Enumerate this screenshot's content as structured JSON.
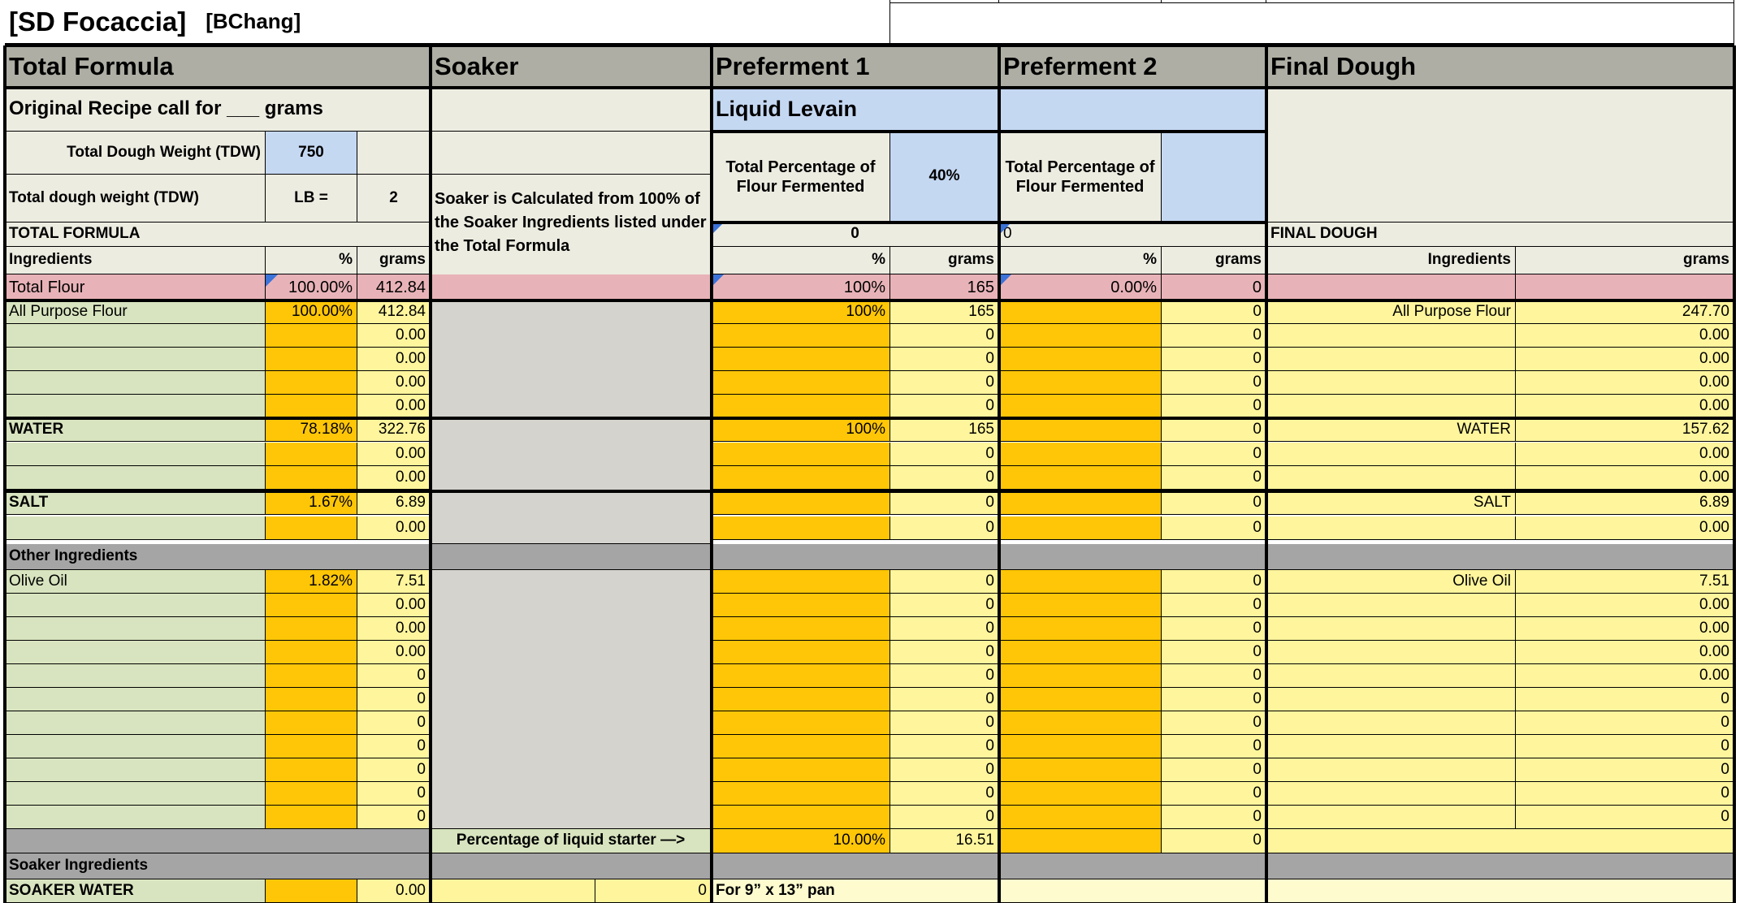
{
  "title": {
    "name": "[SD Focaccia]",
    "author": "[BChang]"
  },
  "sections": {
    "total_formula": "Total Formula",
    "soaker": "Soaker",
    "preferment1": "Preferment 1",
    "preferment2": "Preferment 2",
    "final_dough": "Final Dough"
  },
  "total_formula": {
    "original_recipe": "Original Recipe call for ___ grams",
    "tdw_label": "Total Dough Weight (TDW)",
    "tdw_value": "750",
    "tdw_lb_label": "Total dough weight (TDW)",
    "lb_eq": "LB  =",
    "lb_value": "2",
    "section_label": "TOTAL FORMULA",
    "col_ingredients": "Ingredients",
    "col_pct": "%",
    "col_grams": "grams"
  },
  "soaker": {
    "note": "Soaker is Calculated from 100% of the Soaker Ingredients listed under the Total Formula"
  },
  "pf1": {
    "type": "Liquid Levain",
    "pct_label": "Total Percentage of Flour Fermented",
    "pct_value": "40%",
    "sum_value": "0",
    "col_pct": "%",
    "col_grams": "grams"
  },
  "pf2": {
    "type": "",
    "pct_label": "Total Percentage of Flour Fermented",
    "pct_value": "",
    "sum_value": "0",
    "col_pct": "%",
    "col_grams": "grams"
  },
  "final": {
    "section_label": "FINAL DOUGH",
    "col_ingredients": "Ingredients",
    "col_grams": "grams"
  },
  "total_flour": {
    "name": "Total Flour",
    "tf_pct": "100.00%",
    "tf_grams": "412.84",
    "pf1_pct": "100%",
    "pf1_grams": "165",
    "pf2_pct": "0.00%",
    "pf2_grams": "0"
  },
  "other_ingredients_label": "Other Ingredients",
  "rows": [
    {
      "name": "All Purpose Flour",
      "pct": "100.00%",
      "grams": "412.84",
      "p1pct": "100%",
      "p1g": "165",
      "p2g": "0",
      "fname": "All Purpose Flour",
      "fg": "247.70"
    },
    {
      "name": "",
      "pct": "",
      "grams": "0.00",
      "p1pct": "",
      "p1g": "0",
      "p2g": "0",
      "fname": "",
      "fg": "0.00"
    },
    {
      "name": "",
      "pct": "",
      "grams": "0.00",
      "p1pct": "",
      "p1g": "0",
      "p2g": "0",
      "fname": "",
      "fg": "0.00"
    },
    {
      "name": "",
      "pct": "",
      "grams": "0.00",
      "p1pct": "",
      "p1g": "0",
      "p2g": "0",
      "fname": "",
      "fg": "0.00"
    },
    {
      "name": "",
      "pct": "",
      "grams": "0.00",
      "p1pct": "",
      "p1g": "0",
      "p2g": "0",
      "fname": "",
      "fg": "0.00"
    },
    {
      "name": "WATER",
      "pct": "78.18%",
      "grams": "322.76",
      "p1pct": "100%",
      "p1g": "165",
      "p2g": "0",
      "fname": "WATER",
      "fg": "157.62"
    },
    {
      "name": "",
      "pct": "",
      "grams": "0.00",
      "p1pct": "",
      "p1g": "0",
      "p2g": "0",
      "fname": "",
      "fg": "0.00"
    },
    {
      "name": "",
      "pct": "",
      "grams": "0.00",
      "p1pct": "",
      "p1g": "0",
      "p2g": "0",
      "fname": "",
      "fg": "0.00"
    },
    {
      "name": "SALT",
      "pct": "1.67%",
      "grams": "6.89",
      "p1pct": "",
      "p1g": "0",
      "p2g": "0",
      "fname": "SALT",
      "fg": "6.89"
    },
    {
      "name": "",
      "pct": "",
      "grams": "0.00",
      "p1pct": "",
      "p1g": "0",
      "p2g": "0",
      "fname": "",
      "fg": "0.00"
    },
    {
      "name": "Olive Oil",
      "pct": "1.82%",
      "grams": "7.51",
      "p1pct": "",
      "p1g": "0",
      "p2g": "0",
      "fname": "Olive Oil",
      "fg": "7.51"
    },
    {
      "name": "",
      "pct": "",
      "grams": "0.00",
      "p1pct": "",
      "p1g": "0",
      "p2g": "0",
      "fname": "",
      "fg": "0.00"
    },
    {
      "name": "",
      "pct": "",
      "grams": "0.00",
      "p1pct": "",
      "p1g": "0",
      "p2g": "0",
      "fname": "",
      "fg": "0.00"
    },
    {
      "name": "",
      "pct": "",
      "grams": "0.00",
      "p1pct": "",
      "p1g": "0",
      "p2g": "0",
      "fname": "",
      "fg": "0.00"
    },
    {
      "name": "",
      "pct": "",
      "grams": "0",
      "p1pct": "",
      "p1g": "0",
      "p2g": "0",
      "fname": "",
      "fg": "0.00"
    },
    {
      "name": "",
      "pct": "",
      "grams": "0",
      "p1pct": "",
      "p1g": "0",
      "p2g": "0",
      "fname": "",
      "fg": "0"
    },
    {
      "name": "",
      "pct": "",
      "grams": "0",
      "p1pct": "",
      "p1g": "0",
      "p2g": "0",
      "fname": "",
      "fg": "0"
    },
    {
      "name": "",
      "pct": "",
      "grams": "0",
      "p1pct": "",
      "p1g": "0",
      "p2g": "0",
      "fname": "",
      "fg": "0"
    },
    {
      "name": "",
      "pct": "",
      "grams": "0",
      "p1pct": "",
      "p1g": "0",
      "p2g": "0",
      "fname": "",
      "fg": "0"
    },
    {
      "name": "",
      "pct": "",
      "grams": "0",
      "p1pct": "",
      "p1g": "0",
      "p2g": "0",
      "fname": "",
      "fg": "0"
    },
    {
      "name": "",
      "pct": "",
      "grams": "0",
      "p1pct": "",
      "p1g": "0",
      "p2g": "0",
      "fname": "",
      "fg": "0"
    }
  ],
  "liquid_starter": {
    "label": "Percentage of liquid starter —>",
    "pct": "10.00%",
    "grams": "16.51",
    "p2g": "0"
  },
  "soaker_ingredients_label": "Soaker Ingredients",
  "soaker_water": {
    "name": "SOAKER WATER",
    "grams": "0.00",
    "soaker_val": "0",
    "pan_note": "For 9” x 13” pan"
  }
}
